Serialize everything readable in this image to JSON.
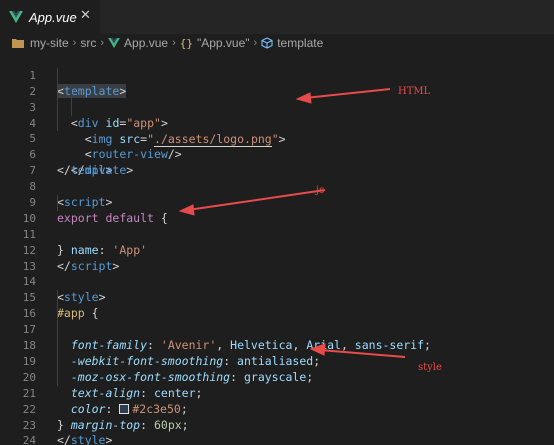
{
  "tab": {
    "title": "App.vue",
    "close": "✕",
    "icon": "vue-logo-icon"
  },
  "breadcrumb": {
    "project": "my-site",
    "folder": "src",
    "file": "App.vue",
    "block": "\"App.vue\"",
    "node": "template",
    "separator": "›",
    "braces": "{}"
  },
  "colors": {
    "background": "#1e1e1e",
    "tag": "#569cd6",
    "attribute": "#9cdcfe",
    "string": "#ce9178",
    "keyword": "#c586c0",
    "selector": "#d7ba7d",
    "number": "#b5cea8",
    "annotation": "#e84b4b"
  },
  "code": {
    "line_numbers": [
      "1",
      "2",
      "3",
      "4",
      "5",
      "6",
      "7",
      "8",
      "9",
      "10",
      "11",
      "12",
      "13",
      "14",
      "15",
      "16",
      "17",
      "18",
      "19",
      "20",
      "21",
      "22",
      "23",
      "24"
    ],
    "l1": {
      "open": "<",
      "tag": "template",
      "close": ">"
    },
    "l2": {
      "indent": "  ",
      "open": "<",
      "tag": "div",
      "space": " ",
      "attr": "id",
      "eq": "=",
      "value": "\"app\"",
      "close": ">"
    },
    "l3": {
      "indent": "    ",
      "open": "<",
      "tag": "img",
      "space": " ",
      "attr": "src",
      "eq": "=",
      "q1": "\"",
      "path": "./assets/logo.png",
      "q2": "\"",
      "close": ">"
    },
    "l4": {
      "indent": "    ",
      "open": "<",
      "tag": "router-view",
      "close": "/>"
    },
    "l5": {
      "indent": "  ",
      "open": "</",
      "tag": "div",
      "close": ">"
    },
    "l6": {
      "open": "</",
      "tag": "template",
      "close": ">"
    },
    "l8": {
      "open": "<",
      "tag": "script",
      "close": ">"
    },
    "l9": {
      "kw1": "export",
      "space": " ",
      "kw2": "default",
      "rest": " {"
    },
    "l10": {
      "indent": "  ",
      "key": "name",
      "colon": ": ",
      "value": "'App'"
    },
    "l11": {
      "text": "}"
    },
    "l12": {
      "open": "</",
      "tag": "script",
      "close": ">"
    },
    "l14": {
      "open": "<",
      "tag": "style",
      "close": ">"
    },
    "l15": {
      "selector": "#app",
      "rest": " {"
    },
    "l16": {
      "indent": "  ",
      "prop": "font-family",
      "colon": ": ",
      "v1": "'Avenir'",
      "c1": ", ",
      "v2": "Helvetica",
      "c2": ", ",
      "v3": "Arial",
      "c3": ", ",
      "v4": "sans-serif",
      "end": ";"
    },
    "l17": {
      "indent": "  ",
      "prop": "-webkit-font-smoothing",
      "colon": ": ",
      "value": "antialiased",
      "end": ";"
    },
    "l18": {
      "indent": "  ",
      "prop": "-moz-osx-font-smoothing",
      "colon": ": ",
      "value": "grayscale",
      "end": ";"
    },
    "l19": {
      "indent": "  ",
      "prop": "text-align",
      "colon": ": ",
      "value": "center",
      "end": ";"
    },
    "l20": {
      "indent": "  ",
      "prop": "color",
      "colon": ": ",
      "value": "#2c3e50",
      "end": ";"
    },
    "l21": {
      "indent": "  ",
      "prop": "margin-top",
      "colon": ": ",
      "value": "60px",
      "end": ";"
    },
    "l22": {
      "text": "}"
    },
    "l23": {
      "open": "</",
      "tag": "style",
      "close": ">"
    }
  },
  "annotations": {
    "html": "HTML",
    "js": "js",
    "style": "style"
  }
}
